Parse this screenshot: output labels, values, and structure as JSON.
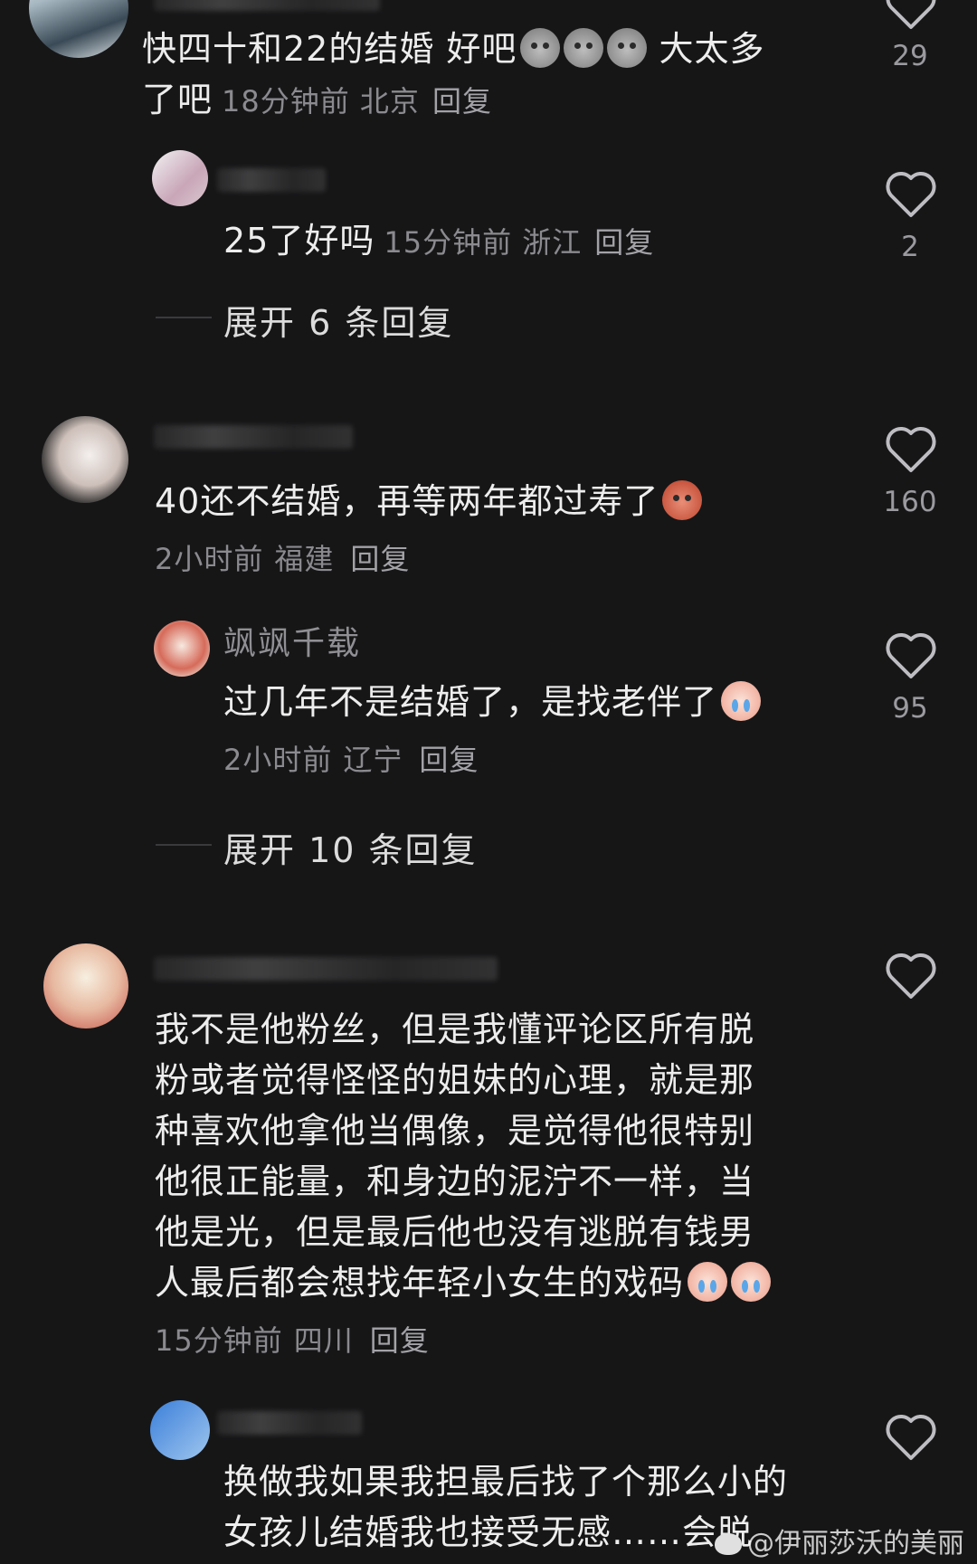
{
  "comments": [
    {
      "text_line1": "快四十和22的结婚 好吧",
      "text_line1_tail": "大太多",
      "text_line2": "了吧",
      "time": "18分钟前",
      "location": "北京",
      "reply": "回复",
      "likes": "29"
    },
    {
      "text": "25了好吗",
      "time": "15分钟前",
      "location": "浙江",
      "reply": "回复",
      "likes": "2"
    },
    {
      "expand": "展开 6 条回复"
    },
    {
      "text": "40还不结婚，再等两年都过寿了",
      "time": "2小时前",
      "location": "福建",
      "reply": "回复",
      "likes": "160"
    },
    {
      "username": "飒飒千载",
      "text": "过几年不是结婚了，是找老伴了",
      "time": "2小时前",
      "location": "辽宁",
      "reply": "回复",
      "likes": "95"
    },
    {
      "expand": "展开 10 条回复"
    },
    {
      "lines": [
        "我不是他粉丝，但是我懂评论区所有脱",
        "粉或者觉得怪怪的姐妹的心理，就是那",
        "种喜欢他拿他当偶像，是觉得他很特别",
        "他很正能量，和身边的泥泞不一样，当",
        "他是光，但是最后他也没有逃脱有钱男",
        "人最后都会想找年轻小女生的戏码"
      ],
      "time": "15分钟前",
      "location": "四川",
      "reply": "回复"
    },
    {
      "lines": [
        "换做我如果我担最后找了个那么小的",
        "女孩儿结婚我也接受无感……会脱"
      ]
    }
  ],
  "watermark": "@伊丽莎沃的美丽",
  "icons": [
    "heart-icon",
    "emoji-icon",
    "weibo-icon"
  ]
}
